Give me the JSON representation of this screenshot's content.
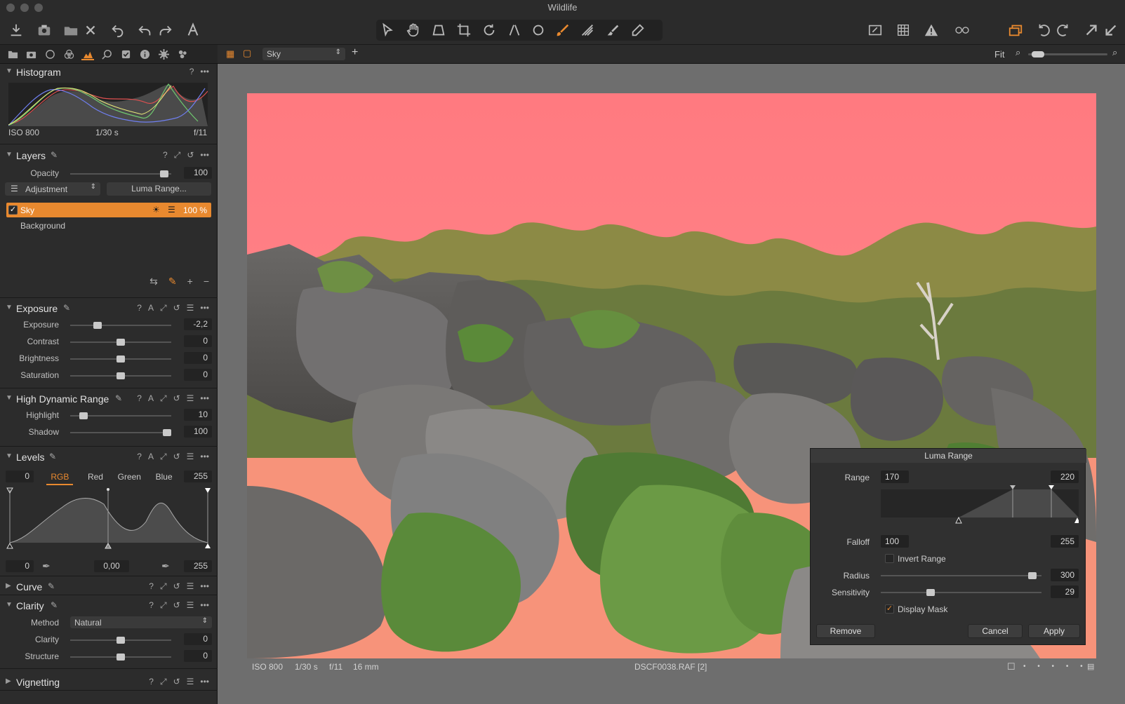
{
  "window": {
    "title": "Wildlife"
  },
  "viewer": {
    "variant_name": "Sky",
    "zoom_label": "Fit",
    "zoom_level": 0.05
  },
  "histogram": {
    "title": "Histogram",
    "iso": "ISO 800",
    "shutter": "1/30 s",
    "aperture": "f/11"
  },
  "layers": {
    "title": "Layers",
    "opacity_label": "Opacity",
    "opacity_value": "100",
    "adjustment_label": "Adjustment",
    "luma_button": "Luma Range...",
    "items": [
      {
        "name": "Sky",
        "opacity": "100 %",
        "checked": true,
        "selected": true
      },
      {
        "name": "Background",
        "opacity": "",
        "checked": false,
        "selected": false
      }
    ]
  },
  "exposure": {
    "title": "Exposure",
    "rows": [
      {
        "label": "Exposure",
        "value": "-2,2",
        "pos": 0.25
      },
      {
        "label": "Contrast",
        "value": "0",
        "pos": 0.5
      },
      {
        "label": "Brightness",
        "value": "0",
        "pos": 0.5
      },
      {
        "label": "Saturation",
        "value": "0",
        "pos": 0.5
      }
    ]
  },
  "hdr": {
    "title": "High Dynamic Range",
    "rows": [
      {
        "label": "Highlight",
        "value": "10",
        "pos": 0.1
      },
      {
        "label": "Shadow",
        "value": "100",
        "pos": 1.0
      }
    ]
  },
  "levels": {
    "title": "Levels",
    "input_low": "0",
    "input_high": "255",
    "channels": [
      "RGB",
      "Red",
      "Green",
      "Blue"
    ],
    "active_channel": "RGB",
    "output_low": "0",
    "midtone": "0,00",
    "output_high": "255"
  },
  "curve": {
    "title": "Curve"
  },
  "clarity": {
    "title": "Clarity",
    "method_label": "Method",
    "method_value": "Natural",
    "rows": [
      {
        "label": "Clarity",
        "value": "0",
        "pos": 0.5
      },
      {
        "label": "Structure",
        "value": "0",
        "pos": 0.5
      }
    ]
  },
  "vignetting": {
    "title": "Vignetting"
  },
  "photo_meta": {
    "iso": "ISO 800",
    "shutter": "1/30 s",
    "aperture": "f/11",
    "focal": "16 mm",
    "filename": "DSCF0038.RAF [2]"
  },
  "luma_dialog": {
    "title": "Luma Range",
    "range_label": "Range",
    "range_low": "170",
    "range_high": "220",
    "falloff_label": "Falloff",
    "falloff_low": "100",
    "falloff_high": "255",
    "invert_label": "Invert Range",
    "invert_checked": false,
    "radius_label": "Radius",
    "radius_value": "300",
    "radius_pos": 0.97,
    "sensitivity_label": "Sensitivity",
    "sensitivity_value": "29",
    "sensitivity_pos": 0.3,
    "display_mask_label": "Display Mask",
    "display_mask_checked": true,
    "remove_label": "Remove",
    "cancel_label": "Cancel",
    "apply_label": "Apply"
  },
  "colors": {
    "accent": "#e8892f",
    "mask": "#ff7b80",
    "panel": "#2c2c2c"
  }
}
